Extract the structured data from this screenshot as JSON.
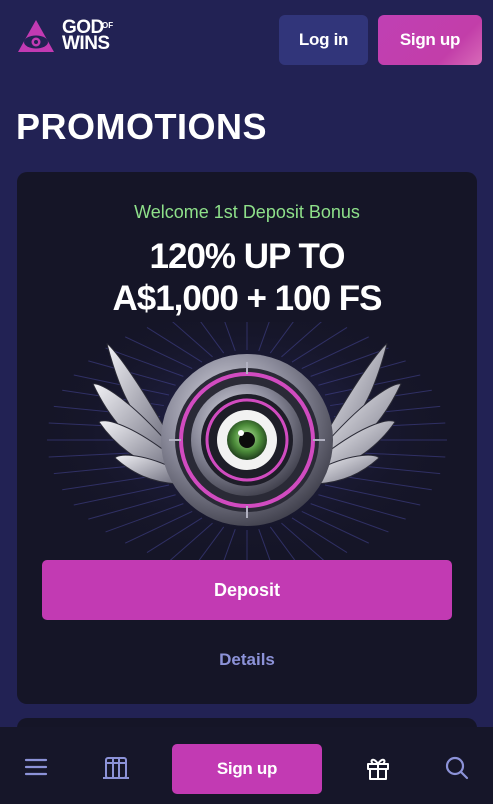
{
  "brand": {
    "name_line1": "GOD",
    "name_sup": "OF",
    "name_line2": "WINS",
    "accent": "#c23ab3",
    "logo_icon": "eye-triangle-icon"
  },
  "header": {
    "login_label": "Log in",
    "signup_label": "Sign up"
  },
  "page": {
    "title": "PROMOTIONS"
  },
  "promo": {
    "subtitle": "Welcome 1st Deposit Bonus",
    "headline_line1": "120% UP TO",
    "headline_line2": "A$1,000 + 100 FS",
    "artwork": "winged-eye-emblem",
    "deposit_label": "Deposit",
    "details_label": "Details"
  },
  "bottom_nav": {
    "items": [
      {
        "icon": "menu-icon"
      },
      {
        "icon": "slot-machine-icon"
      },
      {
        "label": "Sign up"
      },
      {
        "icon": "gift-icon"
      },
      {
        "icon": "search-icon"
      }
    ]
  }
}
